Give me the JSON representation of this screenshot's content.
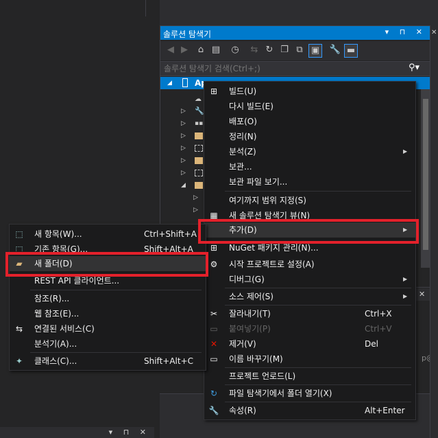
{
  "solution_explorer": {
    "title": "솔루션 탐색기",
    "title_buttons": "▾ ⊓ ✕",
    "search_placeholder": "솔루션 탐색기 검색(Ctrl+;)",
    "selected_item_label": "Ap"
  },
  "bottom_panel": {
    "title_buttons": "▾ ⊓ ✕",
    "side_text": "p@A"
  },
  "context_menu": {
    "items": [
      {
        "label": "빌드(U)",
        "icon": "build-icon"
      },
      {
        "label": "다시 빌드(E)"
      },
      {
        "label": "배포(O)"
      },
      {
        "label": "정리(N)"
      },
      {
        "label": "분석(Z)",
        "submenu": true
      },
      {
        "label": "보관..."
      },
      {
        "label": "보관 파일 보기..."
      },
      {
        "label": "여기까지 범위 지정(S)"
      },
      {
        "label": "새 솔루션 탐색기 뷰(N)",
        "icon": "new-view-icon"
      },
      {
        "label": "추가(D)",
        "submenu": true,
        "highlighted": true
      },
      {
        "label": "NuGet 패키지 관리(N)...",
        "icon": "nuget-icon"
      },
      {
        "label": "시작 프로젝트로 설정(A)",
        "icon": "gear-icon"
      },
      {
        "label": "디버그(G)",
        "submenu": true
      },
      {
        "label": "소스 제어(S)",
        "submenu": true
      },
      {
        "label": "잘라내기(T)",
        "shortcut": "Ctrl+X",
        "icon": "cut-icon"
      },
      {
        "label": "붙여넣기(P)",
        "shortcut": "Ctrl+V",
        "disabled": true,
        "icon": "paste-icon"
      },
      {
        "label": "제거(V)",
        "shortcut": "Del",
        "icon": "remove-icon"
      },
      {
        "label": "이름 바꾸기(M)",
        "icon": "rename-icon"
      },
      {
        "label": "프로젝트 언로드(L)"
      },
      {
        "label": "파일 탐색기에서 폴더 열기(X)",
        "icon": "refresh-icon"
      },
      {
        "label": "속성(R)",
        "shortcut": "Alt+Enter",
        "icon": "wrench-icon"
      }
    ]
  },
  "add_submenu": {
    "items": [
      {
        "label": "새 항목(W)...",
        "shortcut": "Ctrl+Shift+A",
        "icon": "new-item-icon"
      },
      {
        "label": "기존 항목(G)...",
        "shortcut": "Shift+Alt+A",
        "icon": "existing-item-icon"
      },
      {
        "label": "새 폴더(D)",
        "highlighted": true,
        "icon": "new-folder-icon"
      },
      {
        "label": "REST API 클라이언트..."
      },
      {
        "label": "참조(R)..."
      },
      {
        "label": "웹 참조(E)..."
      },
      {
        "label": "연결된 서비스(C)",
        "icon": "connected-service-icon"
      },
      {
        "label": "분석기(A)..."
      },
      {
        "label": "클래스(C)...",
        "shortcut": "Shift+Alt+C",
        "icon": "class-icon"
      }
    ]
  },
  "colors": {
    "accent": "#007acc",
    "menu_bg": "#1b1b1c",
    "highlight_box": "#e3212b",
    "remove_icon": "#e51400"
  }
}
